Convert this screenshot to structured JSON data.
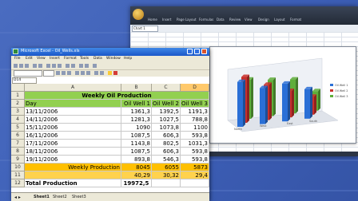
{
  "back_window": {
    "title": "",
    "ribbon_tabs": [
      "Home",
      "Insert",
      "Page Layout",
      "Formulas",
      "Data",
      "Review",
      "View",
      "Design",
      "Layout",
      "Format"
    ],
    "name_box": "Chart 1",
    "chart": {
      "legend": [
        "Oil Well 1",
        "Oil Well 2",
        "Oil Well 3"
      ],
      "colors": [
        "#2a6fd6",
        "#c9302c",
        "#5fae3a"
      ],
      "categories": [
        "North",
        "West",
        "East",
        "South"
      ]
    }
  },
  "front_window": {
    "title": "Microsoft Excel - Oil_Wells.xls",
    "menu": [
      "File",
      "Edit",
      "View",
      "Insert",
      "Format",
      "Tools",
      "Data",
      "Window",
      "Help"
    ],
    "name_box": "D14",
    "columns": [
      "A",
      "B",
      "C",
      "D"
    ],
    "selected_column": "D",
    "rows": [
      {
        "n": "1",
        "a": "Weekly Oil Production",
        "b": "",
        "c": "",
        "d": "",
        "style": "title"
      },
      {
        "n": "2",
        "a": "Day",
        "b": "Oil Well 1",
        "c": "Oil Well 2",
        "d": "Oil Well 3",
        "style": "header"
      },
      {
        "n": "3",
        "a": "13/11/2006",
        "b": "1361,3",
        "c": "1392,5",
        "d": "1191,3"
      },
      {
        "n": "4",
        "a": "14/11/2006",
        "b": "1281,3",
        "c": "1027,5",
        "d": "788,8"
      },
      {
        "n": "5",
        "a": "15/11/2006",
        "b": "1090",
        "c": "1073,8",
        "d": "1100"
      },
      {
        "n": "6",
        "a": "16/11/2006",
        "b": "1087,5",
        "c": "606,3",
        "d": "593,8"
      },
      {
        "n": "7",
        "a": "17/11/2006",
        "b": "1143,8",
        "c": "802,5",
        "d": "1031,3"
      },
      {
        "n": "8",
        "a": "18/11/2006",
        "b": "1087,5",
        "c": "606,3",
        "d": "593,8"
      },
      {
        "n": "9",
        "a": "19/11/2006",
        "b": "893,8",
        "c": "546,3",
        "d": "593,8"
      },
      {
        "n": "10",
        "a": "Weekly Production",
        "b": "8045",
        "c": "6055",
        "d": "5873",
        "style": "weekly"
      },
      {
        "n": "11",
        "a": "",
        "b": "40,29",
        "c": "30,32",
        "d": "29,4",
        "style": "pct"
      },
      {
        "n": "12",
        "a": "Total Production",
        "b": "19972,5",
        "c": "",
        "d": "",
        "style": "total"
      }
    ],
    "sheet_tabs": [
      "Sheet1",
      "Sheet2",
      "Sheet3"
    ]
  }
}
